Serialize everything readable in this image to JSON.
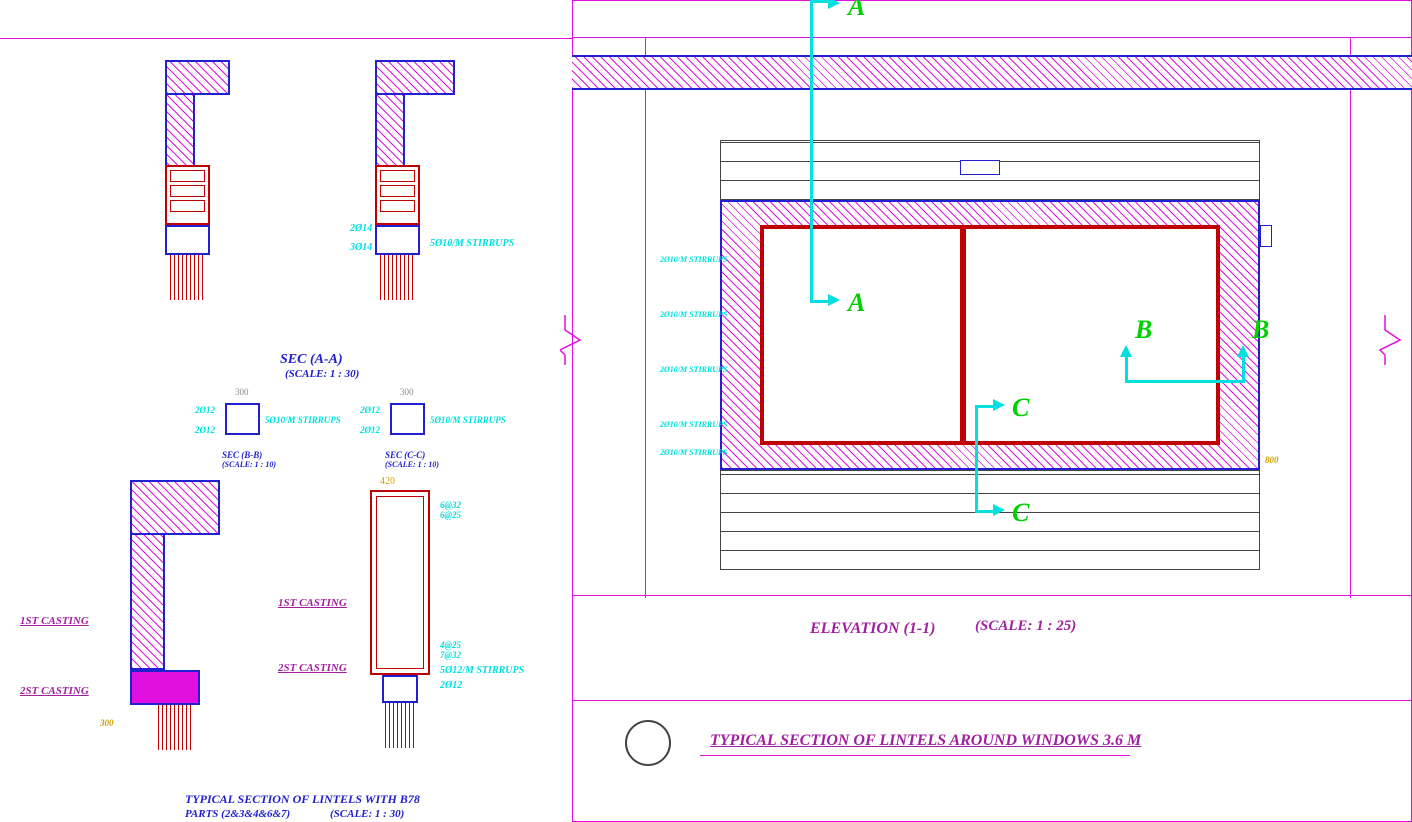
{
  "sec_aa": {
    "title": "SEC (A-A)",
    "scale": "(SCALE: 1 : 30)"
  },
  "sec_bb": {
    "title": "SEC (B-B)",
    "scale": "(SCALE: 1 : 10)"
  },
  "sec_cc": {
    "title": "SEC (C-C)",
    "scale": "(SCALE: 1 : 10)"
  },
  "lintels_b78": {
    "title": "TYPICAL SECTION OF LINTELS WITH B78",
    "parts": "PARTS (2&3&4&6&7)",
    "scale": "(SCALE: 1 : 30)"
  },
  "elevation": {
    "title": "ELEVATION  (1-1)",
    "scale": "(SCALE: 1 : 25)"
  },
  "main_title": "TYPICAL SECTION OF LINTELS AROUND WINDOWS 3.6 M",
  "rebar": {
    "r2o14": "2Ø14",
    "r3o14": "3Ø14",
    "r5o10": "5Ø10/M  STIRRUPS",
    "r2o12": "2Ø12",
    "r5o10ms": "5Ø10/M STIRRUPS",
    "r6a32": "6@32",
    "r6a25": "6@25",
    "r4a25": "4@25",
    "r7a32": "7@32",
    "r5o12": "5Ø12/M  STIRRUPS",
    "dim300": "300",
    "dim420": "420",
    "dim800": "800"
  },
  "cast": {
    "c1": "1ST CASTING",
    "c2": "2ST CASTING"
  },
  "stirr": "2Ø10/M STIRRUPS",
  "sec_labels": {
    "a": "A",
    "b": "B",
    "c": "C"
  }
}
